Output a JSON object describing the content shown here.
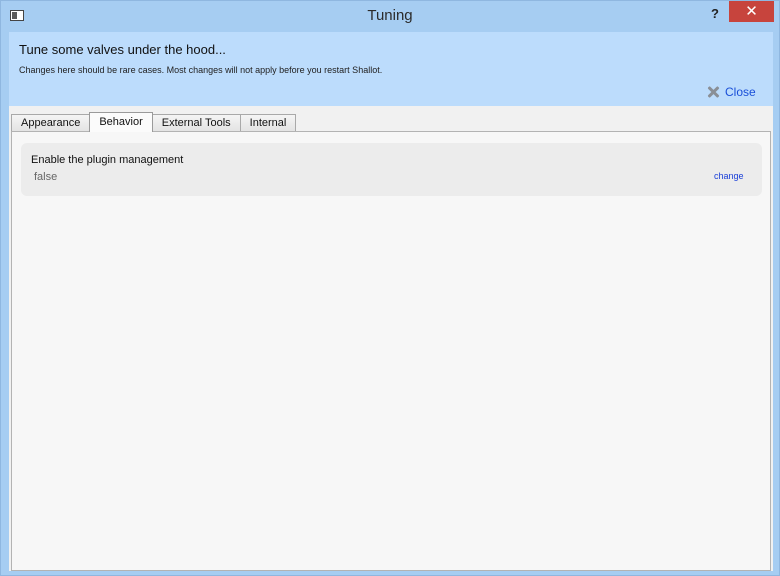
{
  "window": {
    "title": "Tuning",
    "help_label": "?",
    "close_label": "✕"
  },
  "header": {
    "title": "Tune some valves under the hood...",
    "subtitle": "Changes here should be rare cases. Most changes will not apply before you restart Shallot.",
    "close_label": "Close"
  },
  "tabs": [
    {
      "label": "Appearance"
    },
    {
      "label": "Behavior"
    },
    {
      "label": "External Tools"
    },
    {
      "label": "Internal"
    }
  ],
  "active_tab": "Behavior",
  "settings": [
    {
      "label": "Enable the plugin management",
      "value": "false",
      "action": "change"
    }
  ],
  "colors": {
    "window_frame": "#a6cdf2",
    "header_bg": "#bcdcfc",
    "close_button": "#c7443d",
    "link": "#1a3fd8"
  }
}
